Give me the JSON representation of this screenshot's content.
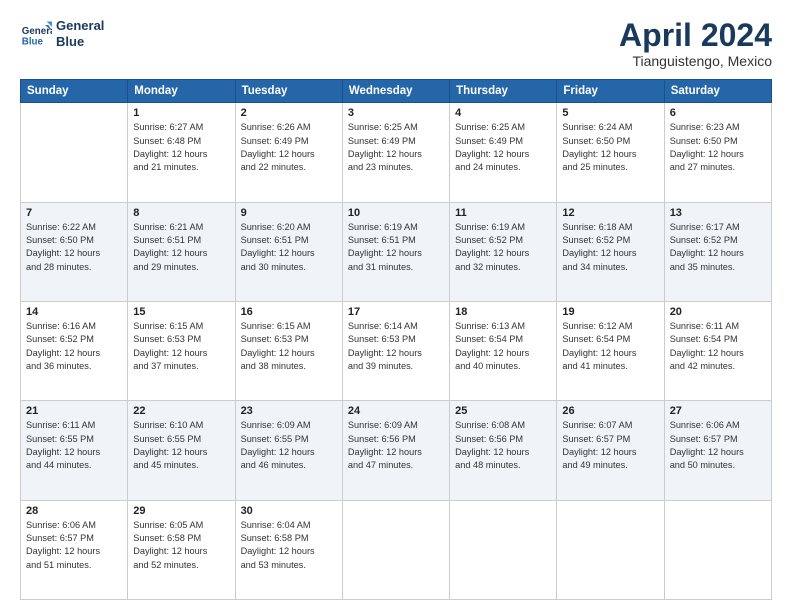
{
  "header": {
    "logo_line1": "General",
    "logo_line2": "Blue",
    "month_year": "April 2024",
    "location": "Tianguistengo, Mexico"
  },
  "weekdays": [
    "Sunday",
    "Monday",
    "Tuesday",
    "Wednesday",
    "Thursday",
    "Friday",
    "Saturday"
  ],
  "weeks": [
    [
      {
        "num": "",
        "info": ""
      },
      {
        "num": "1",
        "info": "Sunrise: 6:27 AM\nSunset: 6:48 PM\nDaylight: 12 hours\nand 21 minutes."
      },
      {
        "num": "2",
        "info": "Sunrise: 6:26 AM\nSunset: 6:49 PM\nDaylight: 12 hours\nand 22 minutes."
      },
      {
        "num": "3",
        "info": "Sunrise: 6:25 AM\nSunset: 6:49 PM\nDaylight: 12 hours\nand 23 minutes."
      },
      {
        "num": "4",
        "info": "Sunrise: 6:25 AM\nSunset: 6:49 PM\nDaylight: 12 hours\nand 24 minutes."
      },
      {
        "num": "5",
        "info": "Sunrise: 6:24 AM\nSunset: 6:50 PM\nDaylight: 12 hours\nand 25 minutes."
      },
      {
        "num": "6",
        "info": "Sunrise: 6:23 AM\nSunset: 6:50 PM\nDaylight: 12 hours\nand 27 minutes."
      }
    ],
    [
      {
        "num": "7",
        "info": "Sunrise: 6:22 AM\nSunset: 6:50 PM\nDaylight: 12 hours\nand 28 minutes."
      },
      {
        "num": "8",
        "info": "Sunrise: 6:21 AM\nSunset: 6:51 PM\nDaylight: 12 hours\nand 29 minutes."
      },
      {
        "num": "9",
        "info": "Sunrise: 6:20 AM\nSunset: 6:51 PM\nDaylight: 12 hours\nand 30 minutes."
      },
      {
        "num": "10",
        "info": "Sunrise: 6:19 AM\nSunset: 6:51 PM\nDaylight: 12 hours\nand 31 minutes."
      },
      {
        "num": "11",
        "info": "Sunrise: 6:19 AM\nSunset: 6:52 PM\nDaylight: 12 hours\nand 32 minutes."
      },
      {
        "num": "12",
        "info": "Sunrise: 6:18 AM\nSunset: 6:52 PM\nDaylight: 12 hours\nand 34 minutes."
      },
      {
        "num": "13",
        "info": "Sunrise: 6:17 AM\nSunset: 6:52 PM\nDaylight: 12 hours\nand 35 minutes."
      }
    ],
    [
      {
        "num": "14",
        "info": "Sunrise: 6:16 AM\nSunset: 6:52 PM\nDaylight: 12 hours\nand 36 minutes."
      },
      {
        "num": "15",
        "info": "Sunrise: 6:15 AM\nSunset: 6:53 PM\nDaylight: 12 hours\nand 37 minutes."
      },
      {
        "num": "16",
        "info": "Sunrise: 6:15 AM\nSunset: 6:53 PM\nDaylight: 12 hours\nand 38 minutes."
      },
      {
        "num": "17",
        "info": "Sunrise: 6:14 AM\nSunset: 6:53 PM\nDaylight: 12 hours\nand 39 minutes."
      },
      {
        "num": "18",
        "info": "Sunrise: 6:13 AM\nSunset: 6:54 PM\nDaylight: 12 hours\nand 40 minutes."
      },
      {
        "num": "19",
        "info": "Sunrise: 6:12 AM\nSunset: 6:54 PM\nDaylight: 12 hours\nand 41 minutes."
      },
      {
        "num": "20",
        "info": "Sunrise: 6:11 AM\nSunset: 6:54 PM\nDaylight: 12 hours\nand 42 minutes."
      }
    ],
    [
      {
        "num": "21",
        "info": "Sunrise: 6:11 AM\nSunset: 6:55 PM\nDaylight: 12 hours\nand 44 minutes."
      },
      {
        "num": "22",
        "info": "Sunrise: 6:10 AM\nSunset: 6:55 PM\nDaylight: 12 hours\nand 45 minutes."
      },
      {
        "num": "23",
        "info": "Sunrise: 6:09 AM\nSunset: 6:55 PM\nDaylight: 12 hours\nand 46 minutes."
      },
      {
        "num": "24",
        "info": "Sunrise: 6:09 AM\nSunset: 6:56 PM\nDaylight: 12 hours\nand 47 minutes."
      },
      {
        "num": "25",
        "info": "Sunrise: 6:08 AM\nSunset: 6:56 PM\nDaylight: 12 hours\nand 48 minutes."
      },
      {
        "num": "26",
        "info": "Sunrise: 6:07 AM\nSunset: 6:57 PM\nDaylight: 12 hours\nand 49 minutes."
      },
      {
        "num": "27",
        "info": "Sunrise: 6:06 AM\nSunset: 6:57 PM\nDaylight: 12 hours\nand 50 minutes."
      }
    ],
    [
      {
        "num": "28",
        "info": "Sunrise: 6:06 AM\nSunset: 6:57 PM\nDaylight: 12 hours\nand 51 minutes."
      },
      {
        "num": "29",
        "info": "Sunrise: 6:05 AM\nSunset: 6:58 PM\nDaylight: 12 hours\nand 52 minutes."
      },
      {
        "num": "30",
        "info": "Sunrise: 6:04 AM\nSunset: 6:58 PM\nDaylight: 12 hours\nand 53 minutes."
      },
      {
        "num": "",
        "info": ""
      },
      {
        "num": "",
        "info": ""
      },
      {
        "num": "",
        "info": ""
      },
      {
        "num": "",
        "info": ""
      }
    ]
  ]
}
